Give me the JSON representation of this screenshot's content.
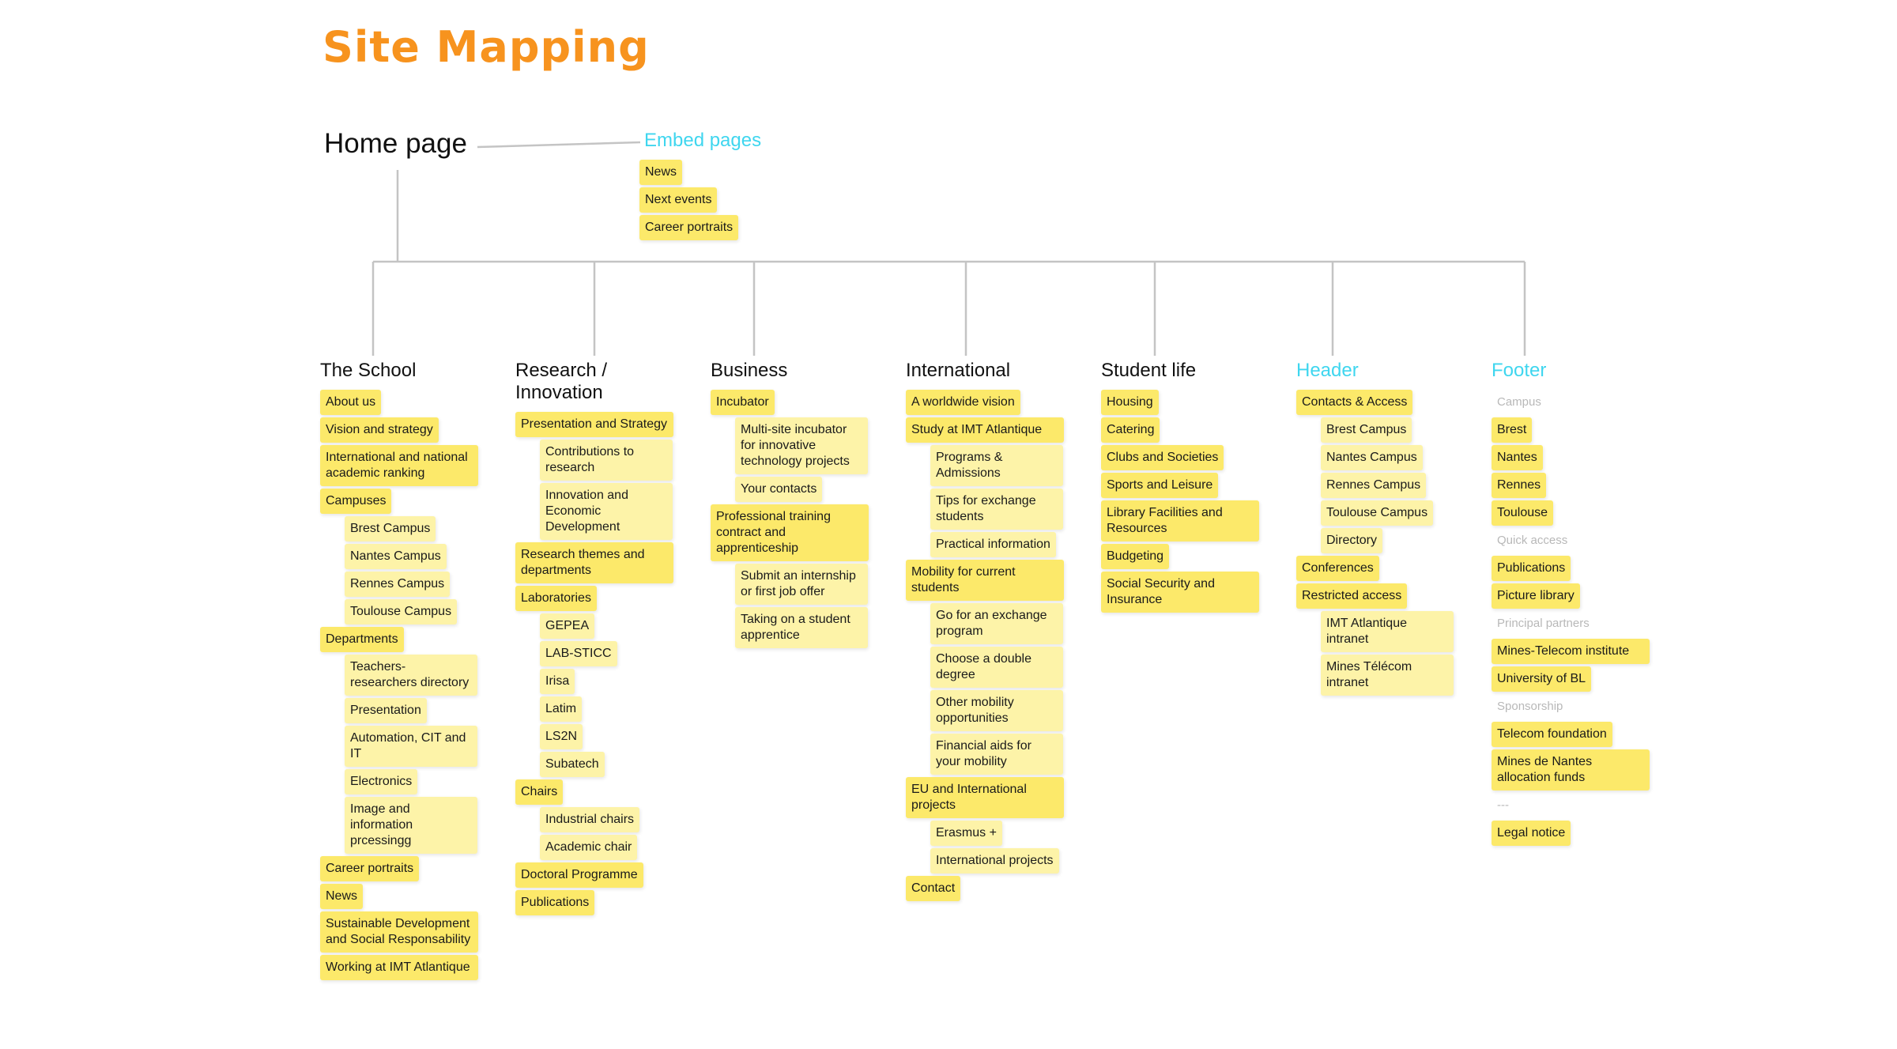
{
  "title": "Site Mapping",
  "root": "Home page",
  "embed": {
    "label": "Embed pages",
    "items": [
      "News",
      "Next events",
      "Career portraits"
    ]
  },
  "colors": {
    "title": "#f7931e",
    "accent_cyan": "#3fd6ef",
    "note_primary": "#fce96a",
    "note_secondary": "#fdf3a8",
    "connector": "#c4c4c4",
    "group_label": "#b8b8b8"
  },
  "columns": [
    {
      "label": "The School",
      "items": [
        {
          "text": "About us",
          "level": 1
        },
        {
          "text": "Vision and strategy",
          "level": 1
        },
        {
          "text": "International and national academic ranking",
          "level": 1
        },
        {
          "text": "Campuses",
          "level": 1
        },
        {
          "text": "Brest Campus",
          "level": 2
        },
        {
          "text": "Nantes Campus",
          "level": 2
        },
        {
          "text": "Rennes Campus",
          "level": 2
        },
        {
          "text": "Toulouse Campus",
          "level": 2
        },
        {
          "text": "Departments",
          "level": 1
        },
        {
          "text": "Teachers-researchers directory",
          "level": 2
        },
        {
          "text": "Presentation",
          "level": 2
        },
        {
          "text": "Automation, CIT and IT",
          "level": 2
        },
        {
          "text": "Electronics",
          "level": 2
        },
        {
          "text": "Image and information prcessingg",
          "level": 2
        },
        {
          "text": "Career portraits",
          "level": 1
        },
        {
          "text": "News",
          "level": 1
        },
        {
          "text": "Sustainable Development and Social Responsability",
          "level": 1
        },
        {
          "text": "Working at IMT Atlantique",
          "level": 1
        }
      ]
    },
    {
      "label": "Research / Innovation",
      "items": [
        {
          "text": "Presentation and Strategy",
          "level": 1
        },
        {
          "text": "Contributions to research",
          "level": 2
        },
        {
          "text": "Innovation and Economic Development",
          "level": 2
        },
        {
          "text": "Research themes and departments",
          "level": 1
        },
        {
          "text": "Laboratories",
          "level": 1
        },
        {
          "text": "GEPEA",
          "level": 2
        },
        {
          "text": "LAB-STICC",
          "level": 2
        },
        {
          "text": "Irisa",
          "level": 2
        },
        {
          "text": "Latim",
          "level": 2
        },
        {
          "text": "LS2N",
          "level": 2
        },
        {
          "text": "Subatech",
          "level": 2
        },
        {
          "text": "Chairs",
          "level": 1
        },
        {
          "text": "Industrial chairs",
          "level": 2
        },
        {
          "text": "Academic chair",
          "level": 2
        },
        {
          "text": "Doctoral Programme",
          "level": 1
        },
        {
          "text": "Publications",
          "level": 1
        }
      ]
    },
    {
      "label": "Business",
      "items": [
        {
          "text": "Incubator",
          "level": 1
        },
        {
          "text": "Multi-site incubator for innovative technology projects",
          "level": 2
        },
        {
          "text": "Your contacts",
          "level": 2
        },
        {
          "text": "Professional training contract and apprenticeship",
          "level": 1
        },
        {
          "text": "Submit an internship or first job offer",
          "level": 2
        },
        {
          "text": "Taking on a student apprentice",
          "level": 2
        }
      ]
    },
    {
      "label": "International",
      "items": [
        {
          "text": "A worldwide vision",
          "level": 1
        },
        {
          "text": "Study at IMT Atlantique",
          "level": 1
        },
        {
          "text": "Programs & Admissions",
          "level": 2
        },
        {
          "text": "Tips for exchange students",
          "level": 2
        },
        {
          "text": "Practical information",
          "level": 2
        },
        {
          "text": "Mobility for current students",
          "level": 1
        },
        {
          "text": "Go for an exchange program",
          "level": 2
        },
        {
          "text": "Choose a double degree",
          "level": 2
        },
        {
          "text": "Other mobility opportunities",
          "level": 2
        },
        {
          "text": "Financial aids for your mobility",
          "level": 2
        },
        {
          "text": "EU and International projects",
          "level": 1
        },
        {
          "text": "Erasmus +",
          "level": 2
        },
        {
          "text": "International projects",
          "level": 2
        },
        {
          "text": "Contact",
          "level": 1
        }
      ]
    },
    {
      "label": "Student life",
      "items": [
        {
          "text": "Housing",
          "level": 1
        },
        {
          "text": "Catering",
          "level": 1
        },
        {
          "text": "Clubs and Societies",
          "level": 1
        },
        {
          "text": "Sports and Leisure",
          "level": 1
        },
        {
          "text": "Library Facilities and Resources",
          "level": 1
        },
        {
          "text": "Budgeting",
          "level": 1
        },
        {
          "text": "Social Security and Insurance",
          "level": 1
        }
      ]
    },
    {
      "label": "Header",
      "accent": true,
      "items": [
        {
          "text": "Contacts & Access",
          "level": 1
        },
        {
          "text": "Brest Campus",
          "level": 2
        },
        {
          "text": "Nantes Campus",
          "level": 2
        },
        {
          "text": "Rennes Campus",
          "level": 2
        },
        {
          "text": "Toulouse Campus",
          "level": 2
        },
        {
          "text": "Directory",
          "level": 2
        },
        {
          "text": "Conferences",
          "level": 1
        },
        {
          "text": "Restricted access",
          "level": 1
        },
        {
          "text": "IMT Atlantique intranet",
          "level": 2
        },
        {
          "text": "Mines Télécom intranet",
          "level": 2
        }
      ]
    },
    {
      "label": "Footer",
      "accent": true,
      "items": [
        {
          "text": "Campus",
          "level": 0
        },
        {
          "text": "Brest",
          "level": 1
        },
        {
          "text": "Nantes",
          "level": 1
        },
        {
          "text": "Rennes",
          "level": 1
        },
        {
          "text": "Toulouse",
          "level": 1
        },
        {
          "text": "Quick access",
          "level": 0
        },
        {
          "text": "Publications",
          "level": 1
        },
        {
          "text": "Picture library",
          "level": 1
        },
        {
          "text": "Principal partners",
          "level": 0
        },
        {
          "text": "Mines-Telecom institute",
          "level": 1
        },
        {
          "text": "University of BL",
          "level": 1
        },
        {
          "text": "Sponsorship",
          "level": 0
        },
        {
          "text": "Telecom foundation",
          "level": 1
        },
        {
          "text": "Mines de Nantes allocation funds",
          "level": 1
        },
        {
          "text": "---",
          "level": 0
        },
        {
          "text": "Legal notice",
          "level": 1
        }
      ]
    }
  ]
}
